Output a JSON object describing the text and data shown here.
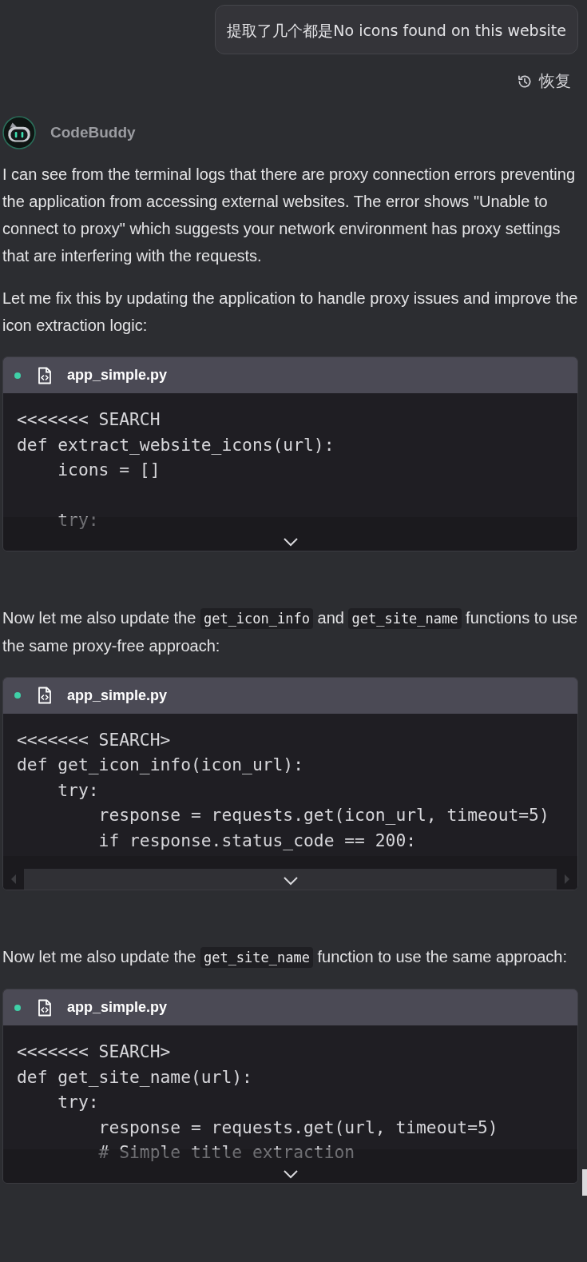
{
  "user_message": {
    "text": "提取了几个都是No icons found on this website"
  },
  "restore_button": {
    "label": "恢复"
  },
  "assistant": {
    "name": "CodeBuddy",
    "blocks": [
      {
        "kind": "paragraph",
        "parts": [
          {
            "kind": "text",
            "text": "I can see from the terminal logs that there are proxy connection errors preventing the application from accessing external websites. The error shows \"Unable to connect to proxy\" which suggests your network environment has proxy settings that are interfering with the requests."
          }
        ]
      },
      {
        "kind": "paragraph",
        "parts": [
          {
            "kind": "text",
            "text": "Let me fix this by updating the application to handle proxy issues and improve the icon extraction logic:"
          }
        ]
      },
      {
        "kind": "code",
        "filename": "app_simple.py",
        "collapsed": true,
        "lines": [
          {
            "kind": "code",
            "text": "<<<<<<< SEARCH"
          },
          {
            "kind": "code",
            "text": "def extract_website_icons(url):"
          },
          {
            "kind": "code",
            "text": "    icons = []"
          },
          {
            "kind": "blank"
          },
          {
            "kind": "code",
            "text": "    try:"
          }
        ]
      },
      {
        "kind": "paragraph",
        "parts": [
          {
            "kind": "text",
            "text": "Now let me also update the "
          },
          {
            "kind": "code",
            "text": "get_icon_info"
          },
          {
            "kind": "text",
            "text": " and "
          },
          {
            "kind": "code",
            "text": "get_site_name"
          },
          {
            "kind": "text",
            "text": " functions to use the same proxy-free approach:"
          }
        ]
      },
      {
        "kind": "code",
        "filename": "app_simple.py",
        "collapsed": true,
        "horizontal_scrollbar": true,
        "lines": [
          {
            "kind": "code",
            "text": "<<<<<<< SEARCH>"
          },
          {
            "kind": "code",
            "text": "def get_icon_info(icon_url):"
          },
          {
            "kind": "code",
            "text": "    try:"
          },
          {
            "kind": "code",
            "text": "        response = requests.get(icon_url, timeout=5)"
          },
          {
            "kind": "code",
            "text": "        if response.status_code == 200:"
          }
        ]
      },
      {
        "kind": "paragraph",
        "parts": [
          {
            "kind": "text",
            "text": "Now let me also update the "
          },
          {
            "kind": "code",
            "text": "get_site_name"
          },
          {
            "kind": "text",
            "text": " function to use the same approach:"
          }
        ]
      },
      {
        "kind": "code",
        "filename": "app_simple.py",
        "collapsed": true,
        "lines": [
          {
            "kind": "code",
            "text": "<<<<<<< SEARCH>"
          },
          {
            "kind": "code",
            "text": "def get_site_name(url):"
          },
          {
            "kind": "code",
            "text": "    try:"
          },
          {
            "kind": "code",
            "text": "        response = requests.get(url, timeout=5)"
          },
          {
            "kind": "code",
            "text": "        # Simple title extraction"
          }
        ]
      }
    ]
  }
}
